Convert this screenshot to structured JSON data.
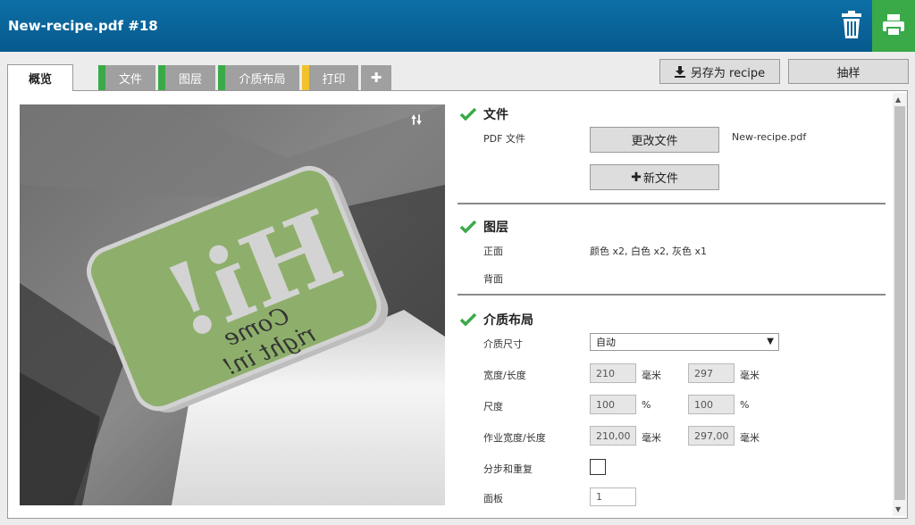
{
  "header": {
    "title": "New-recipe.pdf #18"
  },
  "tabs": {
    "active": "概览",
    "items": [
      {
        "label": "文件",
        "color": "#3aaa48"
      },
      {
        "label": "图层",
        "color": "#3aaa48"
      },
      {
        "label": "介质布局",
        "color": "#3aaa48"
      },
      {
        "label": "打印",
        "color": "#f2c12e"
      }
    ],
    "add_label": "✚"
  },
  "toolbar": {
    "save_recipe": "另存为 recipe",
    "sample": "抽样"
  },
  "preview": {
    "card_text_big": "Hi!",
    "card_text_script_1": "Come",
    "card_text_script_2": "right in!"
  },
  "sections": {
    "file": {
      "title": "文件",
      "pdf_label": "PDF 文件",
      "change_button": "更改文件",
      "filename": "New-recipe.pdf",
      "new_button": "新文件"
    },
    "layers": {
      "title": "图层",
      "front_label": "正面",
      "front_value": "颜色 x2, 白色 x2, 灰色 x1",
      "back_label": "背面"
    },
    "media": {
      "title": "介质布局",
      "size_label": "介质尺寸",
      "size_value": "自动",
      "wh_label": "宽度/长度",
      "width": "210",
      "length": "297",
      "unit_mm": "毫米",
      "scale_label": "尺度",
      "scale_x": "100",
      "scale_y": "100",
      "unit_pct": "%",
      "job_wh_label": "作业宽度/长度",
      "job_width": "210,00",
      "job_length": "297,00",
      "step_label": "分步和重复",
      "panel_label": "面板",
      "panel_value": "1"
    }
  },
  "colors": {
    "accent_green": "#3aaa48",
    "header_blue": "#0c6fa6",
    "print_yellow": "#f2c12e"
  }
}
